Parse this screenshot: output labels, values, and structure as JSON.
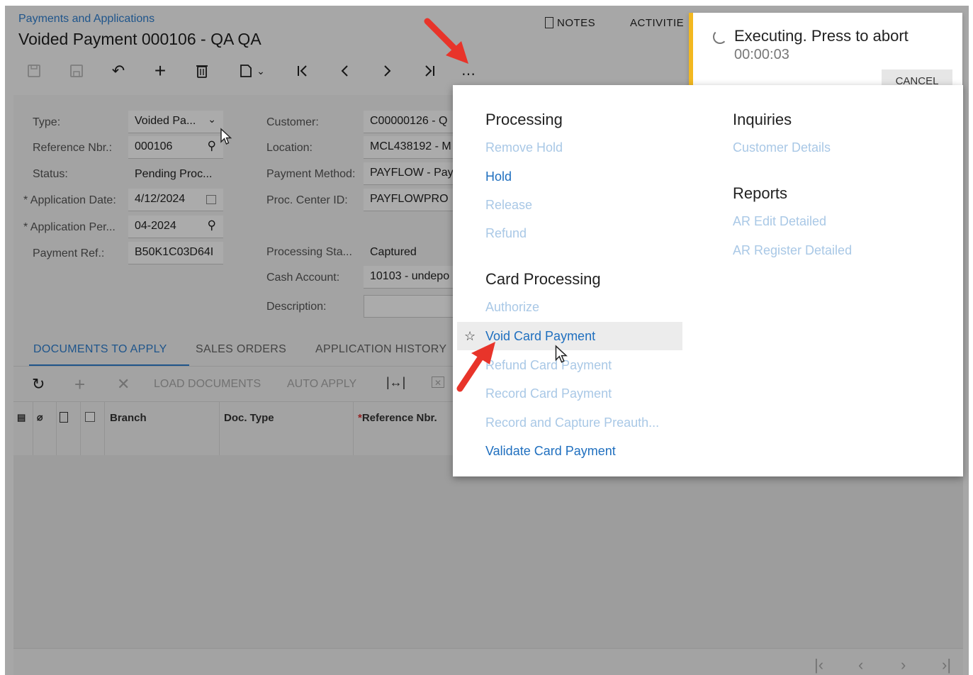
{
  "header": {
    "breadcrumb": "Payments and Applications",
    "title": "Voided Payment 000106 - QA QA",
    "notes_label": "NOTES",
    "activities_label": "ACTIVITIE"
  },
  "toolbar": {
    "icons": [
      "save-close-icon",
      "save-icon",
      "undo-icon",
      "add-icon",
      "delete-icon",
      "copy-paste-icon",
      "first-record-icon",
      "previous-icon",
      "next-icon",
      "last-record-icon",
      "more-actions-icon"
    ]
  },
  "form": {
    "type_label": "Type:",
    "type_value": "Voided Pa...",
    "ref_label": "Reference Nbr.:",
    "ref_value": "000106",
    "status_label": "Status:",
    "status_value": "Pending Proc...",
    "app_date_label": "Application Date:",
    "app_date_value": "4/12/2024",
    "app_period_label": "Application Per...",
    "app_period_value": "04-2024",
    "payment_ref_label": "Payment Ref.:",
    "payment_ref_value": "B50K1C03D64I",
    "customer_label": "Customer:",
    "customer_value": "C00000126 - Q",
    "location_label": "Location:",
    "location_value": "MCL438192 - M",
    "payment_method_label": "Payment Method:",
    "payment_method_value": "PAYFLOW - Pay",
    "proc_center_label": "Proc. Center ID:",
    "proc_center_value": "PAYFLOWPRO",
    "processing_status_label": "Processing Sta...",
    "processing_status_value": "Captured",
    "cash_account_label": "Cash Account:",
    "cash_account_value": "10103 - undepo",
    "description_label": "Description:",
    "required_mark": "*"
  },
  "tabs": [
    "DOCUMENTS TO APPLY",
    "SALES ORDERS",
    "APPLICATION HISTORY"
  ],
  "grid_toolbar": {
    "load_documents": "LOAD DOCUMENTS",
    "auto_apply": "AUTO APPLY"
  },
  "grid_columns": [
    "Branch",
    "Doc. Type",
    "Reference Nbr."
  ],
  "toast": {
    "message": "Executing. Press to abort",
    "timer": "00:00:03",
    "cancel": "CANCEL"
  },
  "menu": {
    "processing": {
      "title": "Processing",
      "items": [
        {
          "label": "Remove Hold",
          "enabled": false
        },
        {
          "label": "Hold",
          "enabled": true
        },
        {
          "label": "Release",
          "enabled": false
        },
        {
          "label": "Refund",
          "enabled": false
        }
      ]
    },
    "card_processing": {
      "title": "Card Processing",
      "items": [
        {
          "label": "Authorize",
          "enabled": false
        },
        {
          "label": "Void Card Payment",
          "enabled": true,
          "highlighted": true
        },
        {
          "label": "Refund Card Payment",
          "enabled": false
        },
        {
          "label": "Record Card Payment",
          "enabled": false
        },
        {
          "label": "Record and Capture Preauth...",
          "enabled": false
        },
        {
          "label": "Validate Card Payment",
          "enabled": true
        }
      ]
    },
    "inquiries": {
      "title": "Inquiries",
      "items": [
        {
          "label": "Customer Details",
          "enabled": false
        }
      ]
    },
    "reports": {
      "title": "Reports",
      "items": [
        {
          "label": "AR Edit Detailed",
          "enabled": false
        },
        {
          "label": "AR Register Detailed",
          "enabled": false
        }
      ]
    }
  },
  "colors": {
    "accent": "#2f7fd0",
    "link_enabled": "#1f6fbf",
    "link_disabled": "#a9c8e6",
    "toast_bar": "#f3b820",
    "annotation_arrow": "#e8342a"
  }
}
